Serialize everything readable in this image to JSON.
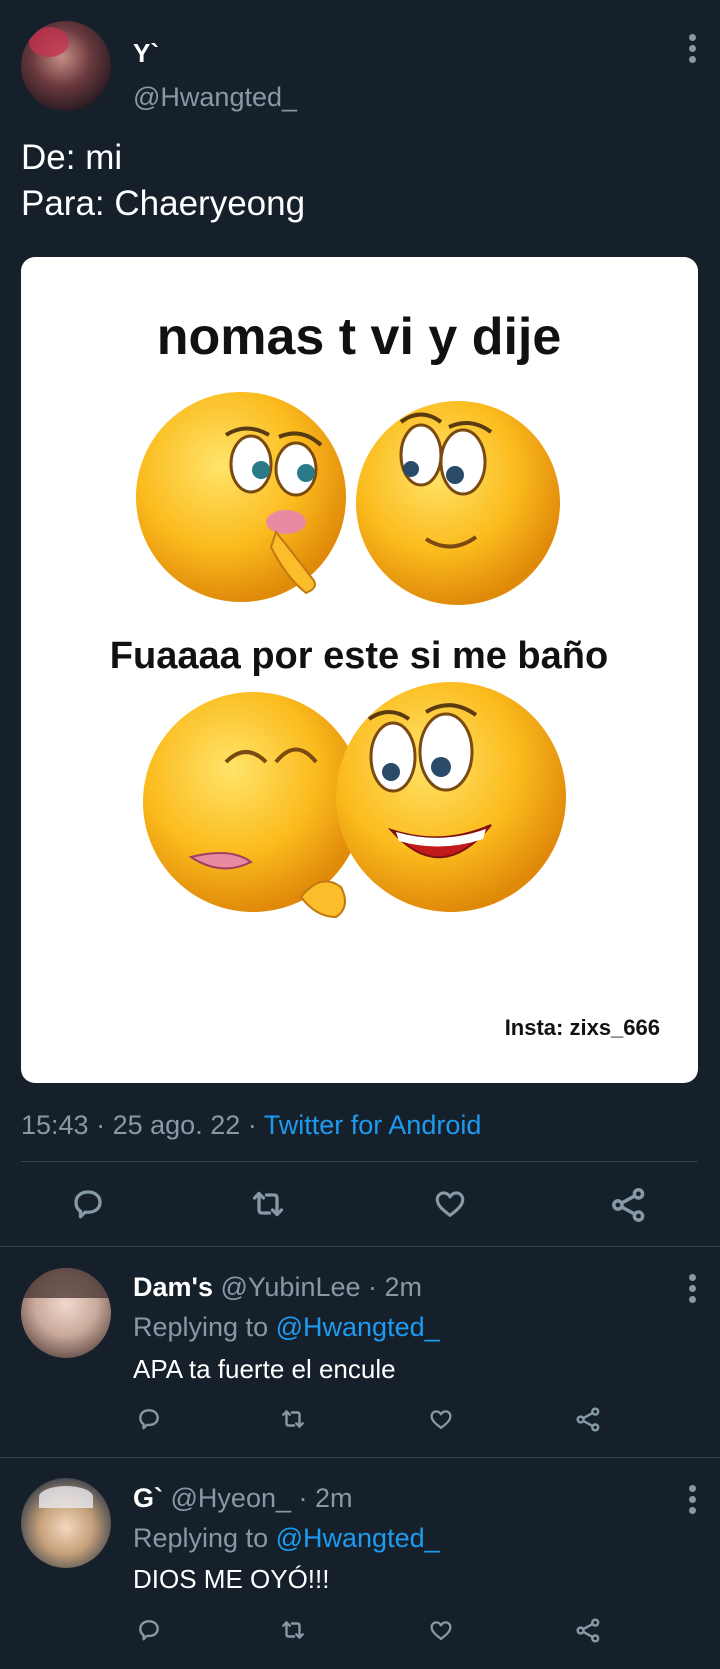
{
  "tweet": {
    "display_name": "Y`",
    "handle": "@Hwangted_",
    "text_line1": "De: mi",
    "text_line2": "Para: Chaeryeong",
    "meme": {
      "top_text": "nomas t vi y dije",
      "middle_text": "Fuaaaa por este si me baño",
      "credit": "Insta: zixs_666"
    },
    "time": "15:43",
    "sep1": "·",
    "date": "25 ago. 22",
    "sep2": "·",
    "source": "Twitter for Android"
  },
  "replies": [
    {
      "display_name": "Dam's",
      "handle": "@YubinLee",
      "time": "· 2m",
      "replying_prefix": "Replying to",
      "replying_handle": "@Hwangted_",
      "text": "APA ta fuerte el encule"
    },
    {
      "display_name": "G`",
      "handle": "@Hyeon_",
      "time": "· 2m",
      "replying_prefix": "Replying to",
      "replying_handle": "@Hwangted_",
      "text": "DIOS ME OYÓ!!!"
    }
  ],
  "icons": [
    "reply-icon",
    "retweet-icon",
    "like-icon",
    "share-icon",
    "more-icon"
  ],
  "colors": {
    "background": "#15202b",
    "muted": "#8899a6",
    "link": "#1d9bf0",
    "divider": "#38444d"
  }
}
